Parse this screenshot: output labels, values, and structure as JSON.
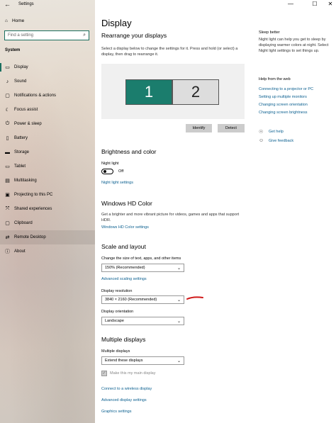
{
  "app": {
    "title": "Settings",
    "back": "←",
    "minimize": "—",
    "maximize": "☐",
    "close": "✕"
  },
  "sidebar": {
    "home": "Home",
    "search_placeholder": "Find a setting",
    "section": "System",
    "items": [
      {
        "label": "Display",
        "icon": "monitor-icon"
      },
      {
        "label": "Sound",
        "icon": "speaker-icon"
      },
      {
        "label": "Notifications & actions",
        "icon": "notification-icon"
      },
      {
        "label": "Focus assist",
        "icon": "moon-icon"
      },
      {
        "label": "Power & sleep",
        "icon": "power-icon"
      },
      {
        "label": "Battery",
        "icon": "battery-icon"
      },
      {
        "label": "Storage",
        "icon": "storage-icon"
      },
      {
        "label": "Tablet",
        "icon": "tablet-icon"
      },
      {
        "label": "Multitasking",
        "icon": "multitasking-icon"
      },
      {
        "label": "Projecting to this PC",
        "icon": "projector-icon"
      },
      {
        "label": "Shared experiences",
        "icon": "shared-icon"
      },
      {
        "label": "Clipboard",
        "icon": "clipboard-icon"
      },
      {
        "label": "Remote Desktop",
        "icon": "remote-icon"
      },
      {
        "label": "About",
        "icon": "info-icon"
      }
    ]
  },
  "main": {
    "title": "Display",
    "rearrange": {
      "heading": "Rearrange your displays",
      "desc": "Select a display below to change the settings for it. Press and hold (or select) a display, then drag to rearrange it.",
      "monitor1": "1",
      "monitor2": "2",
      "identify": "Identify",
      "detect": "Detect"
    },
    "brightness": {
      "heading": "Brightness and color",
      "night_light_label": "Night light",
      "night_light_state": "Off",
      "night_light_link": "Night light settings"
    },
    "hdr": {
      "heading": "Windows HD Color",
      "desc": "Get a brighter and more vibrant picture for videos, games and apps that support HDR.",
      "link": "Windows HD Color settings"
    },
    "scale": {
      "heading": "Scale and layout",
      "size_label": "Change the size of text, apps, and other items",
      "size_value": "150% (Recommended)",
      "advanced_link": "Advanced scaling settings",
      "resolution_label": "Display resolution",
      "resolution_value": "3840 × 2160 (Recommended)",
      "orientation_label": "Display orientation",
      "orientation_value": "Landscape"
    },
    "multiple": {
      "heading": "Multiple displays",
      "label": "Multiple displays",
      "value": "Extend these displays",
      "main_display": "Make this my main display",
      "wireless_link": "Connect to a wireless display",
      "advanced_link": "Advanced display settings",
      "graphics_link": "Graphics settings"
    }
  },
  "side": {
    "sleep_heading": "Sleep better",
    "sleep_desc": "Night light can help you get to sleep by displaying warmer colors at night. Select Night light settings to set things up.",
    "help_heading": "Help from the web",
    "help_links": [
      "Connecting to a projector or PC",
      "Setting up multiple monitors",
      "Changing screen orientation",
      "Changing screen brightness"
    ],
    "get_help": "Get help",
    "give_feedback": "Give feedback"
  }
}
